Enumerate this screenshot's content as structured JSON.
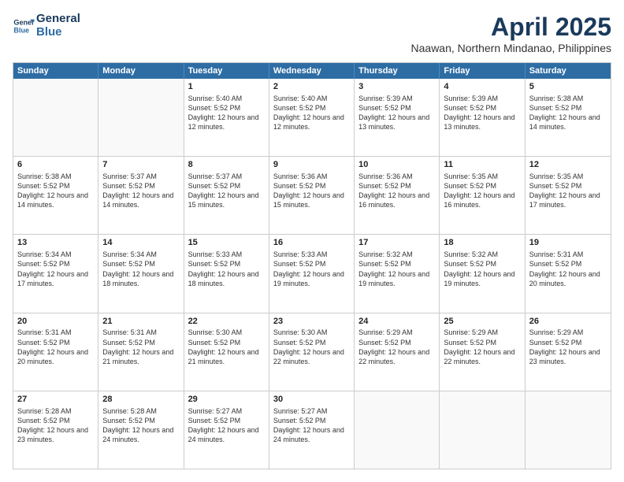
{
  "header": {
    "logo_line1": "General",
    "logo_line2": "Blue",
    "month_year": "April 2025",
    "location": "Naawan, Northern Mindanao, Philippines"
  },
  "days_of_week": [
    "Sunday",
    "Monday",
    "Tuesday",
    "Wednesday",
    "Thursday",
    "Friday",
    "Saturday"
  ],
  "weeks": [
    [
      {
        "day": "",
        "sunrise": "",
        "sunset": "",
        "daylight": "",
        "empty": true
      },
      {
        "day": "",
        "sunrise": "",
        "sunset": "",
        "daylight": "",
        "empty": true
      },
      {
        "day": "1",
        "sunrise": "Sunrise: 5:40 AM",
        "sunset": "Sunset: 5:52 PM",
        "daylight": "Daylight: 12 hours and 12 minutes.",
        "empty": false
      },
      {
        "day": "2",
        "sunrise": "Sunrise: 5:40 AM",
        "sunset": "Sunset: 5:52 PM",
        "daylight": "Daylight: 12 hours and 12 minutes.",
        "empty": false
      },
      {
        "day": "3",
        "sunrise": "Sunrise: 5:39 AM",
        "sunset": "Sunset: 5:52 PM",
        "daylight": "Daylight: 12 hours and 13 minutes.",
        "empty": false
      },
      {
        "day": "4",
        "sunrise": "Sunrise: 5:39 AM",
        "sunset": "Sunset: 5:52 PM",
        "daylight": "Daylight: 12 hours and 13 minutes.",
        "empty": false
      },
      {
        "day": "5",
        "sunrise": "Sunrise: 5:38 AM",
        "sunset": "Sunset: 5:52 PM",
        "daylight": "Daylight: 12 hours and 14 minutes.",
        "empty": false
      }
    ],
    [
      {
        "day": "6",
        "sunrise": "Sunrise: 5:38 AM",
        "sunset": "Sunset: 5:52 PM",
        "daylight": "Daylight: 12 hours and 14 minutes.",
        "empty": false
      },
      {
        "day": "7",
        "sunrise": "Sunrise: 5:37 AM",
        "sunset": "Sunset: 5:52 PM",
        "daylight": "Daylight: 12 hours and 14 minutes.",
        "empty": false
      },
      {
        "day": "8",
        "sunrise": "Sunrise: 5:37 AM",
        "sunset": "Sunset: 5:52 PM",
        "daylight": "Daylight: 12 hours and 15 minutes.",
        "empty": false
      },
      {
        "day": "9",
        "sunrise": "Sunrise: 5:36 AM",
        "sunset": "Sunset: 5:52 PM",
        "daylight": "Daylight: 12 hours and 15 minutes.",
        "empty": false
      },
      {
        "day": "10",
        "sunrise": "Sunrise: 5:36 AM",
        "sunset": "Sunset: 5:52 PM",
        "daylight": "Daylight: 12 hours and 16 minutes.",
        "empty": false
      },
      {
        "day": "11",
        "sunrise": "Sunrise: 5:35 AM",
        "sunset": "Sunset: 5:52 PM",
        "daylight": "Daylight: 12 hours and 16 minutes.",
        "empty": false
      },
      {
        "day": "12",
        "sunrise": "Sunrise: 5:35 AM",
        "sunset": "Sunset: 5:52 PM",
        "daylight": "Daylight: 12 hours and 17 minutes.",
        "empty": false
      }
    ],
    [
      {
        "day": "13",
        "sunrise": "Sunrise: 5:34 AM",
        "sunset": "Sunset: 5:52 PM",
        "daylight": "Daylight: 12 hours and 17 minutes.",
        "empty": false
      },
      {
        "day": "14",
        "sunrise": "Sunrise: 5:34 AM",
        "sunset": "Sunset: 5:52 PM",
        "daylight": "Daylight: 12 hours and 18 minutes.",
        "empty": false
      },
      {
        "day": "15",
        "sunrise": "Sunrise: 5:33 AM",
        "sunset": "Sunset: 5:52 PM",
        "daylight": "Daylight: 12 hours and 18 minutes.",
        "empty": false
      },
      {
        "day": "16",
        "sunrise": "Sunrise: 5:33 AM",
        "sunset": "Sunset: 5:52 PM",
        "daylight": "Daylight: 12 hours and 19 minutes.",
        "empty": false
      },
      {
        "day": "17",
        "sunrise": "Sunrise: 5:32 AM",
        "sunset": "Sunset: 5:52 PM",
        "daylight": "Daylight: 12 hours and 19 minutes.",
        "empty": false
      },
      {
        "day": "18",
        "sunrise": "Sunrise: 5:32 AM",
        "sunset": "Sunset: 5:52 PM",
        "daylight": "Daylight: 12 hours and 19 minutes.",
        "empty": false
      },
      {
        "day": "19",
        "sunrise": "Sunrise: 5:31 AM",
        "sunset": "Sunset: 5:52 PM",
        "daylight": "Daylight: 12 hours and 20 minutes.",
        "empty": false
      }
    ],
    [
      {
        "day": "20",
        "sunrise": "Sunrise: 5:31 AM",
        "sunset": "Sunset: 5:52 PM",
        "daylight": "Daylight: 12 hours and 20 minutes.",
        "empty": false
      },
      {
        "day": "21",
        "sunrise": "Sunrise: 5:31 AM",
        "sunset": "Sunset: 5:52 PM",
        "daylight": "Daylight: 12 hours and 21 minutes.",
        "empty": false
      },
      {
        "day": "22",
        "sunrise": "Sunrise: 5:30 AM",
        "sunset": "Sunset: 5:52 PM",
        "daylight": "Daylight: 12 hours and 21 minutes.",
        "empty": false
      },
      {
        "day": "23",
        "sunrise": "Sunrise: 5:30 AM",
        "sunset": "Sunset: 5:52 PM",
        "daylight": "Daylight: 12 hours and 22 minutes.",
        "empty": false
      },
      {
        "day": "24",
        "sunrise": "Sunrise: 5:29 AM",
        "sunset": "Sunset: 5:52 PM",
        "daylight": "Daylight: 12 hours and 22 minutes.",
        "empty": false
      },
      {
        "day": "25",
        "sunrise": "Sunrise: 5:29 AM",
        "sunset": "Sunset: 5:52 PM",
        "daylight": "Daylight: 12 hours and 22 minutes.",
        "empty": false
      },
      {
        "day": "26",
        "sunrise": "Sunrise: 5:29 AM",
        "sunset": "Sunset: 5:52 PM",
        "daylight": "Daylight: 12 hours and 23 minutes.",
        "empty": false
      }
    ],
    [
      {
        "day": "27",
        "sunrise": "Sunrise: 5:28 AM",
        "sunset": "Sunset: 5:52 PM",
        "daylight": "Daylight: 12 hours and 23 minutes.",
        "empty": false
      },
      {
        "day": "28",
        "sunrise": "Sunrise: 5:28 AM",
        "sunset": "Sunset: 5:52 PM",
        "daylight": "Daylight: 12 hours and 24 minutes.",
        "empty": false
      },
      {
        "day": "29",
        "sunrise": "Sunrise: 5:27 AM",
        "sunset": "Sunset: 5:52 PM",
        "daylight": "Daylight: 12 hours and 24 minutes.",
        "empty": false
      },
      {
        "day": "30",
        "sunrise": "Sunrise: 5:27 AM",
        "sunset": "Sunset: 5:52 PM",
        "daylight": "Daylight: 12 hours and 24 minutes.",
        "empty": false
      },
      {
        "day": "",
        "sunrise": "",
        "sunset": "",
        "daylight": "",
        "empty": true
      },
      {
        "day": "",
        "sunrise": "",
        "sunset": "",
        "daylight": "",
        "empty": true
      },
      {
        "day": "",
        "sunrise": "",
        "sunset": "",
        "daylight": "",
        "empty": true
      }
    ]
  ]
}
